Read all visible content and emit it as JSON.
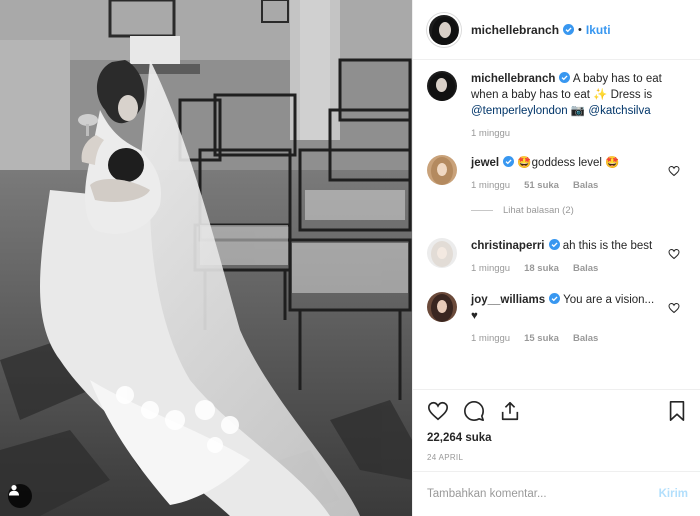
{
  "post": {
    "author": "michellebranch",
    "follow_label": "Ikuti",
    "separator": "•",
    "likes": "22,264 suka",
    "date": "24 APRIL"
  },
  "caption": {
    "username": "michellebranch",
    "text": " A baby has to eat when a baby has to eat ✨ Dress is ",
    "mention_1": "@temperleylondon",
    "mid": " 📷 ",
    "mention_2": "@katchsilva",
    "time": "1 minggu"
  },
  "comments": [
    {
      "username": "jewel",
      "text": "🤩goddess level 🤩",
      "time": "1 minggu",
      "likes": "51 suka",
      "reply": "Balas",
      "view_replies": "Lihat balasan (2)"
    },
    {
      "username": "christinaperri",
      "text": " ah this is the best",
      "time": "1 minggu",
      "likes": "18 suka",
      "reply": "Balas"
    },
    {
      "username": "joy__williams",
      "text": " You are a vision... ♥",
      "time": "1 minggu",
      "likes": "15 suka",
      "reply": "Balas"
    }
  ],
  "input": {
    "placeholder": "Tambahkan komentar...",
    "submit": "Kirim"
  },
  "colors": {
    "link": "#3897f0",
    "mention": "#003569",
    "muted": "#999999",
    "verified": "#3897f0",
    "border": "#efefef"
  },
  "icons": [
    "user-tag-icon",
    "verified-icon",
    "heart-icon",
    "comment-icon",
    "share-icon",
    "bookmark-icon"
  ]
}
